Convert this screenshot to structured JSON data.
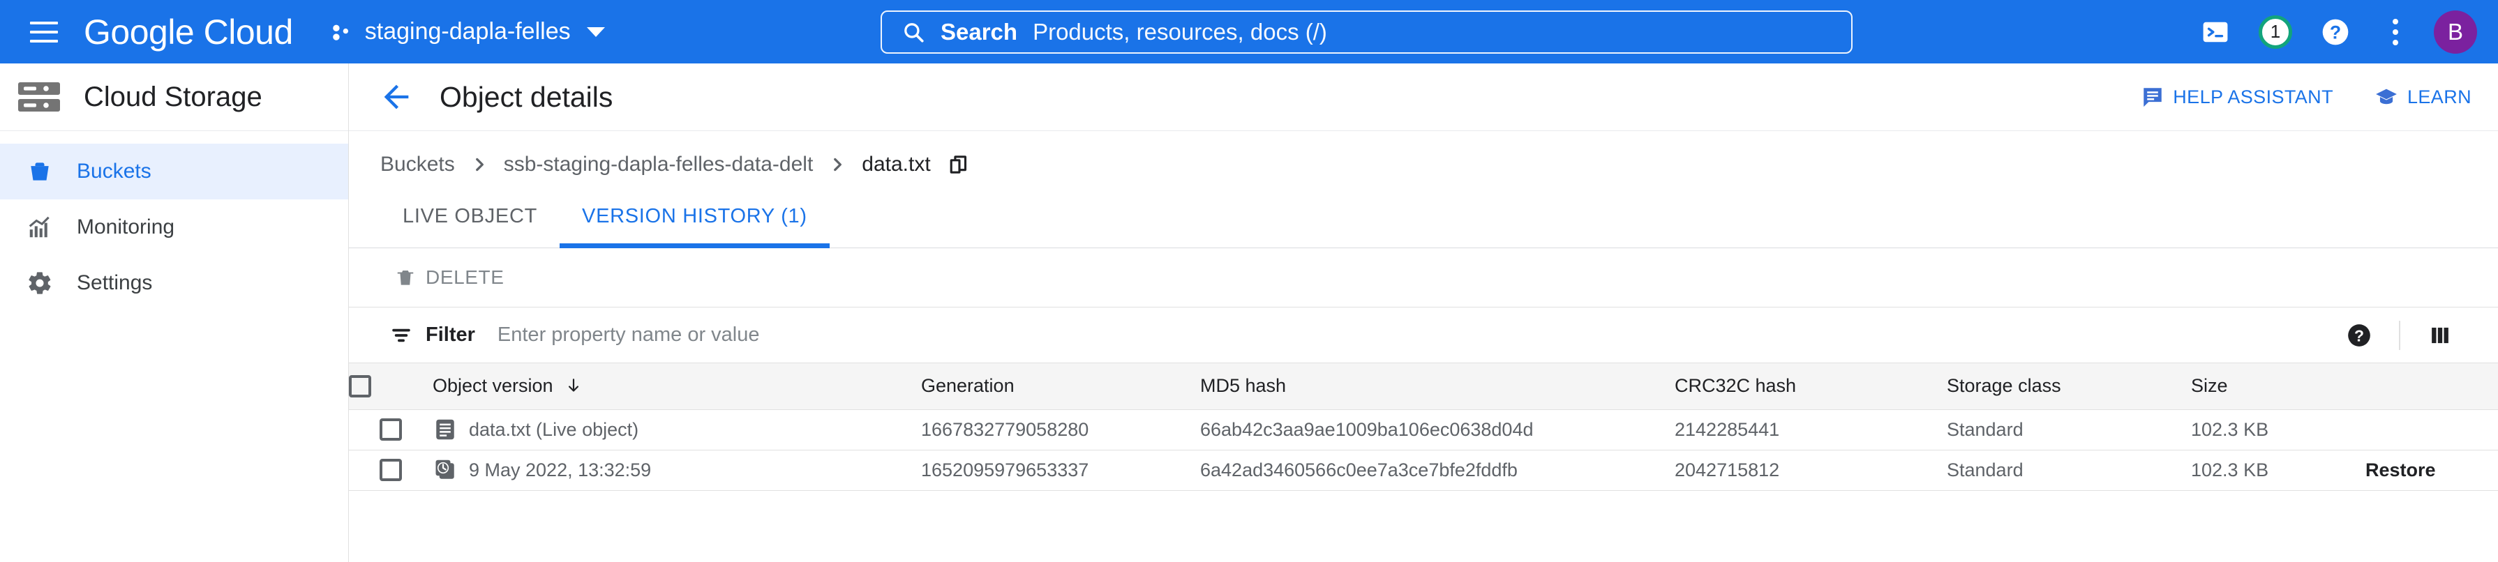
{
  "topbar": {
    "menu_icon": "hamburger-menu-icon",
    "logo_text": "Google Cloud",
    "project": {
      "icon": "project-scope-icon",
      "name": "staging-dapla-felles",
      "chevron": "chevron-down-icon"
    },
    "search": {
      "icon": "search-icon",
      "label": "Search",
      "placeholder": "Products, resources, docs (/)"
    },
    "actions": {
      "cloud_shell": "cloud-shell-icon",
      "notification_count": "1",
      "help": "help-icon",
      "more": "more-vert-icon",
      "avatar_initial": "B"
    }
  },
  "sidebar": {
    "product_icon": "cloud-storage-icon",
    "product_title": "Cloud Storage",
    "items": [
      {
        "label": "Buckets",
        "icon": "bucket-icon",
        "active": true
      },
      {
        "label": "Monitoring",
        "icon": "monitoring-chart-icon",
        "active": false
      },
      {
        "label": "Settings",
        "icon": "gear-icon",
        "active": false
      }
    ]
  },
  "page": {
    "back_icon": "back-arrow-icon",
    "title": "Object details",
    "help_assistant": {
      "label": "HELP ASSISTANT",
      "icon": "chat-bubble-icon"
    },
    "learn": {
      "label": "LEARN",
      "icon": "graduation-cap-icon"
    }
  },
  "breadcrumb": {
    "items": [
      "Buckets",
      "ssb-staging-dapla-felles-data-delt",
      "data.txt"
    ],
    "copy_icon": "copy-icon"
  },
  "tabs": [
    {
      "label": "LIVE OBJECT",
      "active": false
    },
    {
      "label": "VERSION HISTORY (1)",
      "active": true
    }
  ],
  "toolbar": {
    "delete_label": "DELETE",
    "delete_icon": "trash-icon",
    "delete_disabled": true
  },
  "filter": {
    "icon": "filter-icon",
    "label": "Filter",
    "placeholder": "Enter property name or value",
    "value": "",
    "help_icon": "help-filled-icon",
    "columns_icon": "column-display-icon"
  },
  "table": {
    "columns": [
      "Object version",
      "Generation",
      "MD5 hash",
      "CRC32C hash",
      "Storage class",
      "Size"
    ],
    "sort_column": "Object version",
    "sort_icon": "arrow-downward-icon",
    "rows": [
      {
        "icon": "description-file-icon",
        "name": "data.txt (Live object)",
        "generation": "1667832779058280",
        "md5": "66ab42c3aa9ae1009ba106ec0638d04d",
        "crc32c": "2142285441",
        "storage_class": "Standard",
        "size": "102.3 KB",
        "action": "",
        "has_menu": false
      },
      {
        "icon": "history-restore-icon",
        "name": "9 May 2022, 13:32:59",
        "generation": "1652095979653337",
        "md5": "6a42ad3460566c0ee7a3ce7bfe2fddfb",
        "crc32c": "2042715812",
        "storage_class": "Standard",
        "size": "102.3 KB",
        "action": "Restore",
        "has_menu": true
      }
    ]
  },
  "colors": {
    "brand_blue": "#1a73e8",
    "accent_green": "#12a47c",
    "avatar_purple": "#7b219f",
    "text_primary": "#202124",
    "text_secondary": "#5f6368"
  }
}
